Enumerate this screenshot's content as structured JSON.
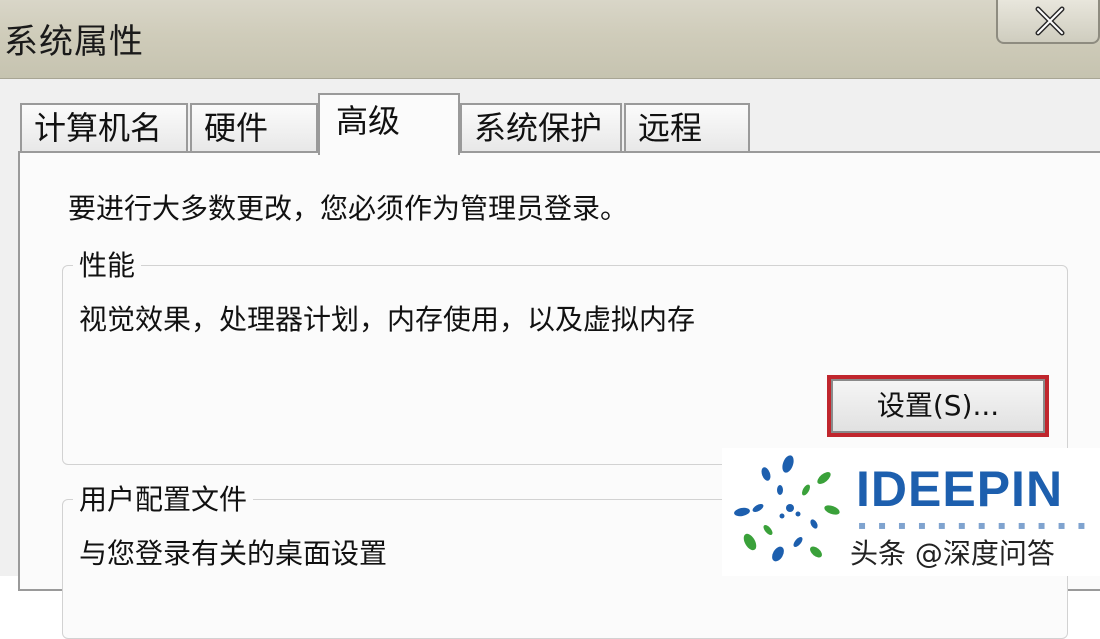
{
  "window": {
    "title": "系统属性",
    "close_icon": "close-x-icon"
  },
  "tabs": [
    {
      "label": "计算机名",
      "active": false
    },
    {
      "label": "硬件",
      "active": false
    },
    {
      "label": "高级",
      "active": true
    },
    {
      "label": "系统保护",
      "active": false
    },
    {
      "label": "远程",
      "active": false
    }
  ],
  "panel": {
    "admin_note": "要进行大多数更改，您必须作为管理员登录。",
    "performance": {
      "legend": "性能",
      "description": "视觉效果，处理器计划，内存使用，以及虚拟内存",
      "settings_button": "设置(S)..."
    },
    "user_profiles": {
      "legend": "用户配置文件",
      "description": "与您登录有关的桌面设置"
    }
  },
  "watermark": {
    "brand": "IDEEPIN",
    "credit": "头条 @深度问答",
    "logo_icon": "spiral-dots-logo"
  },
  "colors": {
    "highlight_border": "#c0262d",
    "brand_blue": "#1d5fae",
    "logo_green": "#3aa13a"
  }
}
